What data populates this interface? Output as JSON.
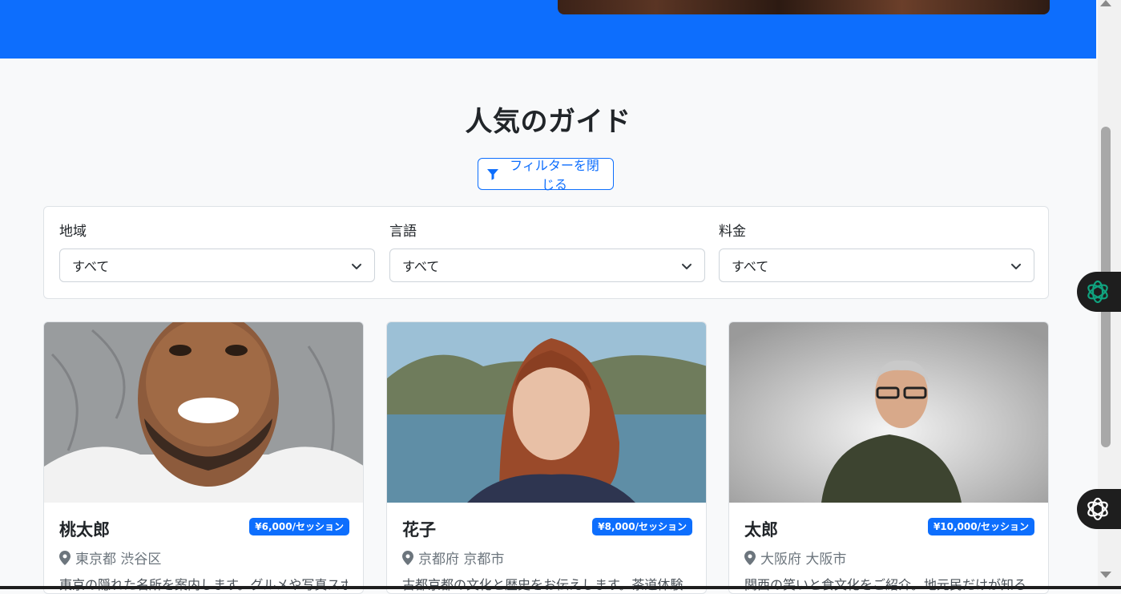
{
  "section": {
    "title": "人気のガイド"
  },
  "filter_toggle": {
    "label": "フィルターを閉じる"
  },
  "filters": [
    {
      "label": "地域",
      "value": "すべて"
    },
    {
      "label": "言語",
      "value": "すべて"
    },
    {
      "label": "料金",
      "value": "すべて"
    }
  ],
  "guides": [
    {
      "name": "桃太郎",
      "price": "¥6,000/セッション",
      "location": "東京都 渋谷区",
      "description": "東京の隠れた名所を案内します。グルメや写真スポ"
    },
    {
      "name": "花子",
      "price": "¥8,000/セッション",
      "location": "京都府 京都市",
      "description": "古都京都の文化と歴史をお伝えします。茶道体験"
    },
    {
      "name": "太郎",
      "price": "¥10,000/セッション",
      "location": "大阪府 大阪市",
      "description": "関西の笑いと食文化をご紹介。地元民だけが知る"
    }
  ],
  "colors": {
    "primary": "#0d6efd",
    "background": "#f8f9fa"
  },
  "icons": {
    "filter": "filter-icon",
    "location": "map-pin-icon",
    "dropdown": "chevron-down-icon"
  }
}
